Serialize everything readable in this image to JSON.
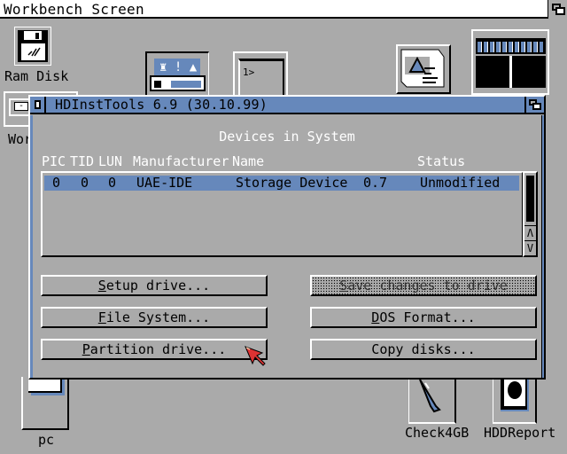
{
  "screen": {
    "title": "Workbench Screen"
  },
  "desktop_icons": [
    {
      "label": "Ram Disk",
      "icon": "ram-disk-icon"
    },
    {
      "label": "Wor",
      "icon": "workbench-drawer-icon"
    },
    {
      "label": "",
      "icon": "prefs-tools-icon"
    },
    {
      "label": "",
      "icon": "shell-icon"
    },
    {
      "label": "",
      "icon": "showconfig-icon"
    },
    {
      "label": "",
      "icon": "monitor-window-icon"
    },
    {
      "label": "pc",
      "icon": "pc-drive-icon"
    },
    {
      "label": "Check4GB",
      "icon": "check4gb-icon"
    },
    {
      "label": "HDDReport",
      "icon": "hddreport-icon"
    }
  ],
  "window": {
    "title": "HDInstTools 6.9 (30.10.99)",
    "heading": "Devices in System",
    "columns": [
      "PIC",
      "TID",
      "LUN",
      "Manufacturer",
      "Name",
      "Status"
    ],
    "rows": [
      {
        "pic": "0",
        "tid": "0",
        "lun": "0",
        "manufacturer": "UAE-IDE",
        "name": "Storage Device",
        "revision": "0.7",
        "status": "Unmodified",
        "selected": true
      }
    ],
    "scroll_up": "Λ",
    "scroll_down": "V",
    "buttons": {
      "setup": {
        "key": "S",
        "rest": "etup drive..."
      },
      "save": {
        "key": "S",
        "rest": "ave changes to drive",
        "disabled": true
      },
      "filesystem": {
        "key": "F",
        "rest": "ile System..."
      },
      "dosformat": {
        "key": "D",
        "rest": "OS Format..."
      },
      "partition": {
        "key": "P",
        "rest": "artition drive..."
      },
      "copy": {
        "label": "Copy disks..."
      }
    }
  },
  "colors": {
    "background": "#aaaaaa",
    "accent": "#6688bb",
    "highlight": "#ffffff",
    "shadow": "#000000",
    "pointer": "#dd3333"
  }
}
